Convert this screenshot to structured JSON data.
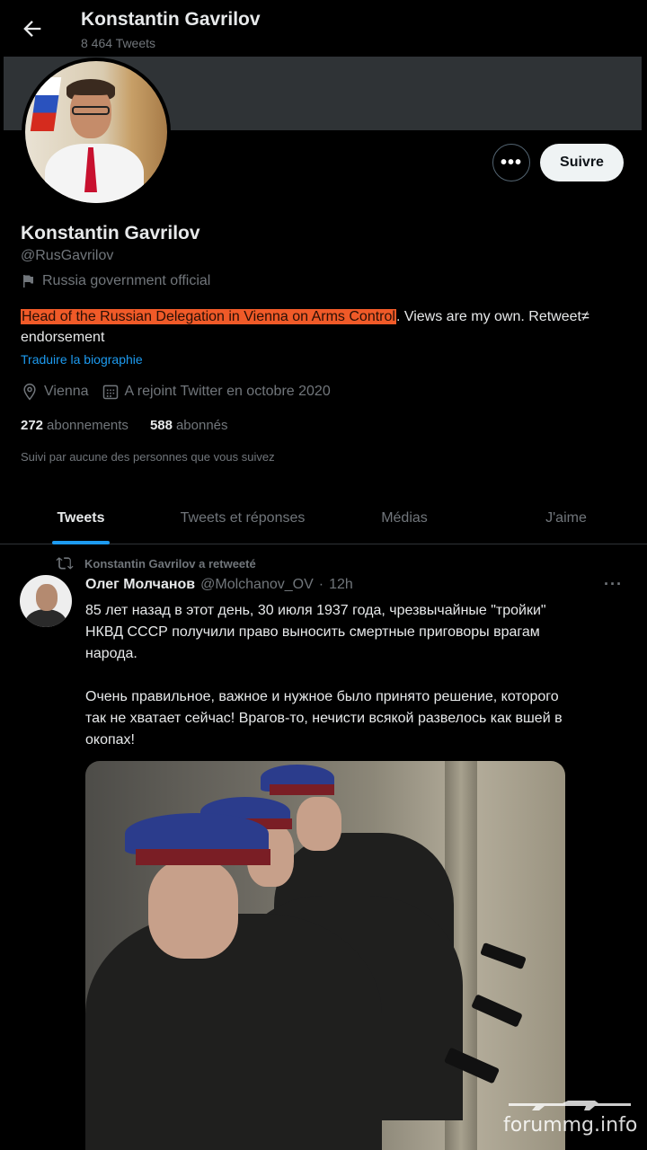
{
  "header": {
    "title": "Konstantin Gavrilov",
    "tweet_count": "8 464 Tweets"
  },
  "profile": {
    "name": "Konstantin Gavrilov",
    "handle": "@RusGavrilov",
    "label": "Russia government official",
    "bio_highlight": "Head of the Russian Delegation in Vienna on Arms Control",
    "bio_rest": ". Views are my own. Retweet≠ endorsement",
    "translate": "Traduire la biographie",
    "location": "Vienna",
    "joined": "A rejoint Twitter en octobre 2020",
    "following_count": "272",
    "following_label": "abonnements",
    "followers_count": "588",
    "followers_label": "abonnés",
    "followed_by": "Suivi par aucune des personnes que vous suivez",
    "more_label": "•••",
    "follow_label": "Suivre"
  },
  "tabs": [
    "Tweets",
    "Tweets et réponses",
    "Médias",
    "J'aime"
  ],
  "tweet": {
    "retweet_context": "Konstantin Gavrilov a retweeté",
    "author": "Олег Молчанов",
    "handle": "@Molchanov_OV",
    "separator": "·",
    "time": "12h",
    "more": "···",
    "text": "85 лет назад в этот день, 30 июля 1937 года, чрезвычайные \"тройки\"\nНКВД СССР получили право выносить смертные приговоры врагам\nнарода.\n\nОчень правильное, важное и нужное было принято решение, которого\nтак не хватает сейчас! Врагов-то, нечисти всякой развелось как вшей в\nокопах!"
  },
  "watermark": "forummg.info",
  "colors": {
    "background": "#000000",
    "accent": "#1d9bf0",
    "highlight": "#f05a28",
    "muted": "#71767b"
  }
}
